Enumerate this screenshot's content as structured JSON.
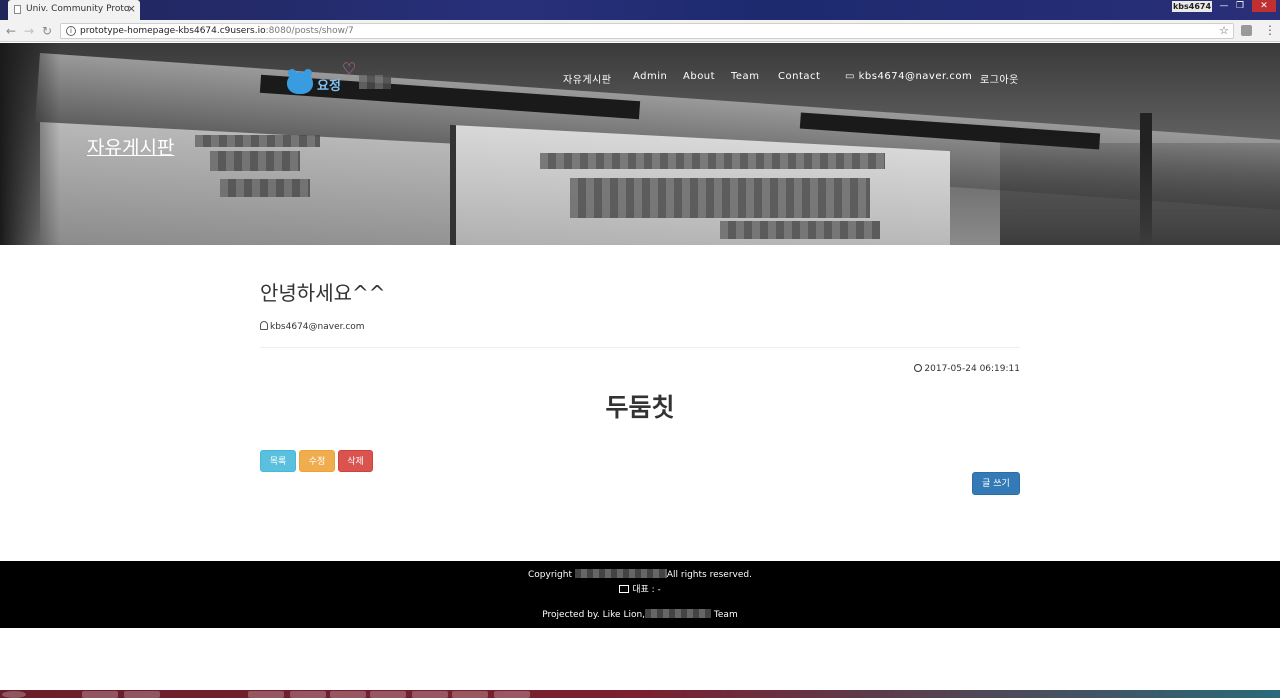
{
  "browser": {
    "tab_title": "Univ. Community Proto",
    "tab_close": "×",
    "user_chip": "kbs4674",
    "url_host": "prototype-homepage-kbs4674.c9users.io",
    "url_rest": ":8080/posts/show/7",
    "win_minimize": "—",
    "win_restore": "❐",
    "win_close": "✕"
  },
  "site": {
    "logo_text": "요정",
    "nav": {
      "board": "자유게시판",
      "admin": "Admin",
      "about": "About",
      "team": "Team",
      "contact": "Contact",
      "user_email": "kbs4674@naver.com",
      "logout": "로그아웃"
    },
    "hero_title": "자유게시판"
  },
  "post": {
    "title": "안녕하세요^^",
    "author": "kbs4674@naver.com",
    "timestamp": "2017-05-24 06:19:11",
    "body": "두둠칫"
  },
  "buttons": {
    "list": "목록",
    "edit": "수정",
    "delete": "삭제",
    "write": "글 쓰기"
  },
  "footer": {
    "copyright_prefix": "Copyright",
    "copyright_suffix": "All rights reserved.",
    "representative": "대표 : -",
    "projected_prefix": "Projected by. Like Lion,",
    "projected_suffix": "Team"
  },
  "colors": {
    "btn_info": "#5bc0de",
    "btn_warning": "#f0ad4e",
    "btn_danger": "#d9534f",
    "btn_primary": "#337ab7",
    "footer_bg": "#000000"
  }
}
